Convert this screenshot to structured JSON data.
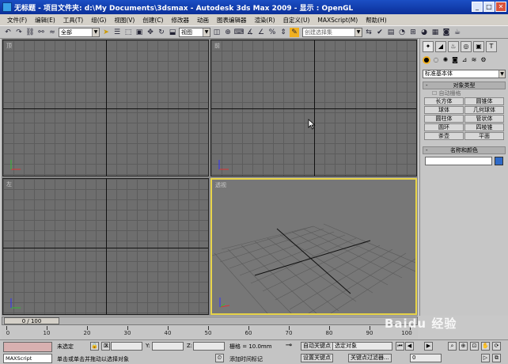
{
  "window": {
    "title": "无标题  - 项目文件夹: d:\\My Documents\\3dsmax  - Autodesk 3ds Max  2009  - 显示 : OpenGL",
    "minimize": "_",
    "maximize": "□",
    "close": "✕"
  },
  "menu": [
    "文件(F)",
    "编辑(E)",
    "工具(T)",
    "组(G)",
    "视图(V)",
    "创建(C)",
    "修改器",
    "动画",
    "图表编辑器",
    "渲染(R)",
    "自定义(U)",
    "MAXScript(M)",
    "帮助(H)"
  ],
  "toolbar": {
    "selection_filter": "全部",
    "reference_coord": "视图",
    "named_selection": "创建选择集"
  },
  "viewports": {
    "top": {
      "label": "顶"
    },
    "front": {
      "label": "前"
    },
    "left": {
      "label": "左"
    },
    "perspective": {
      "label": "透视"
    }
  },
  "command_panel": {
    "category": "标准基本体",
    "object_type_title": "对象类型",
    "autogrid": "自动栅格",
    "objects": [
      "长方体",
      "圆锥体",
      "球体",
      "几何球体",
      "圆柱体",
      "管状体",
      "圆环",
      "四棱锥",
      "茶壶",
      "平面"
    ],
    "name_color_title": "名称和颜色",
    "swatch_color": "#2e6ac8"
  },
  "timeline": {
    "frame_display": "0 / 100",
    "ticks": [
      "0",
      "10",
      "20",
      "30",
      "40",
      "50",
      "60",
      "70",
      "80",
      "90",
      "100"
    ]
  },
  "status": {
    "maxscript_label": "MAXScript",
    "selection_text": "未选定",
    "prompt_text": "单击或单击并拖动以选择对象",
    "x_label": "X:",
    "y_label": "Y:",
    "z_label": "Z:",
    "grid_text": "栅格 = 10.0mm",
    "add_time_tag": "添加时间标记",
    "auto_key": "自动关键点",
    "set_key": "设置关键点",
    "key_mode": "选定对象",
    "key_filters": "关键点过滤器...",
    "frame_value": "0"
  },
  "watermark": "Baidu 经验"
}
